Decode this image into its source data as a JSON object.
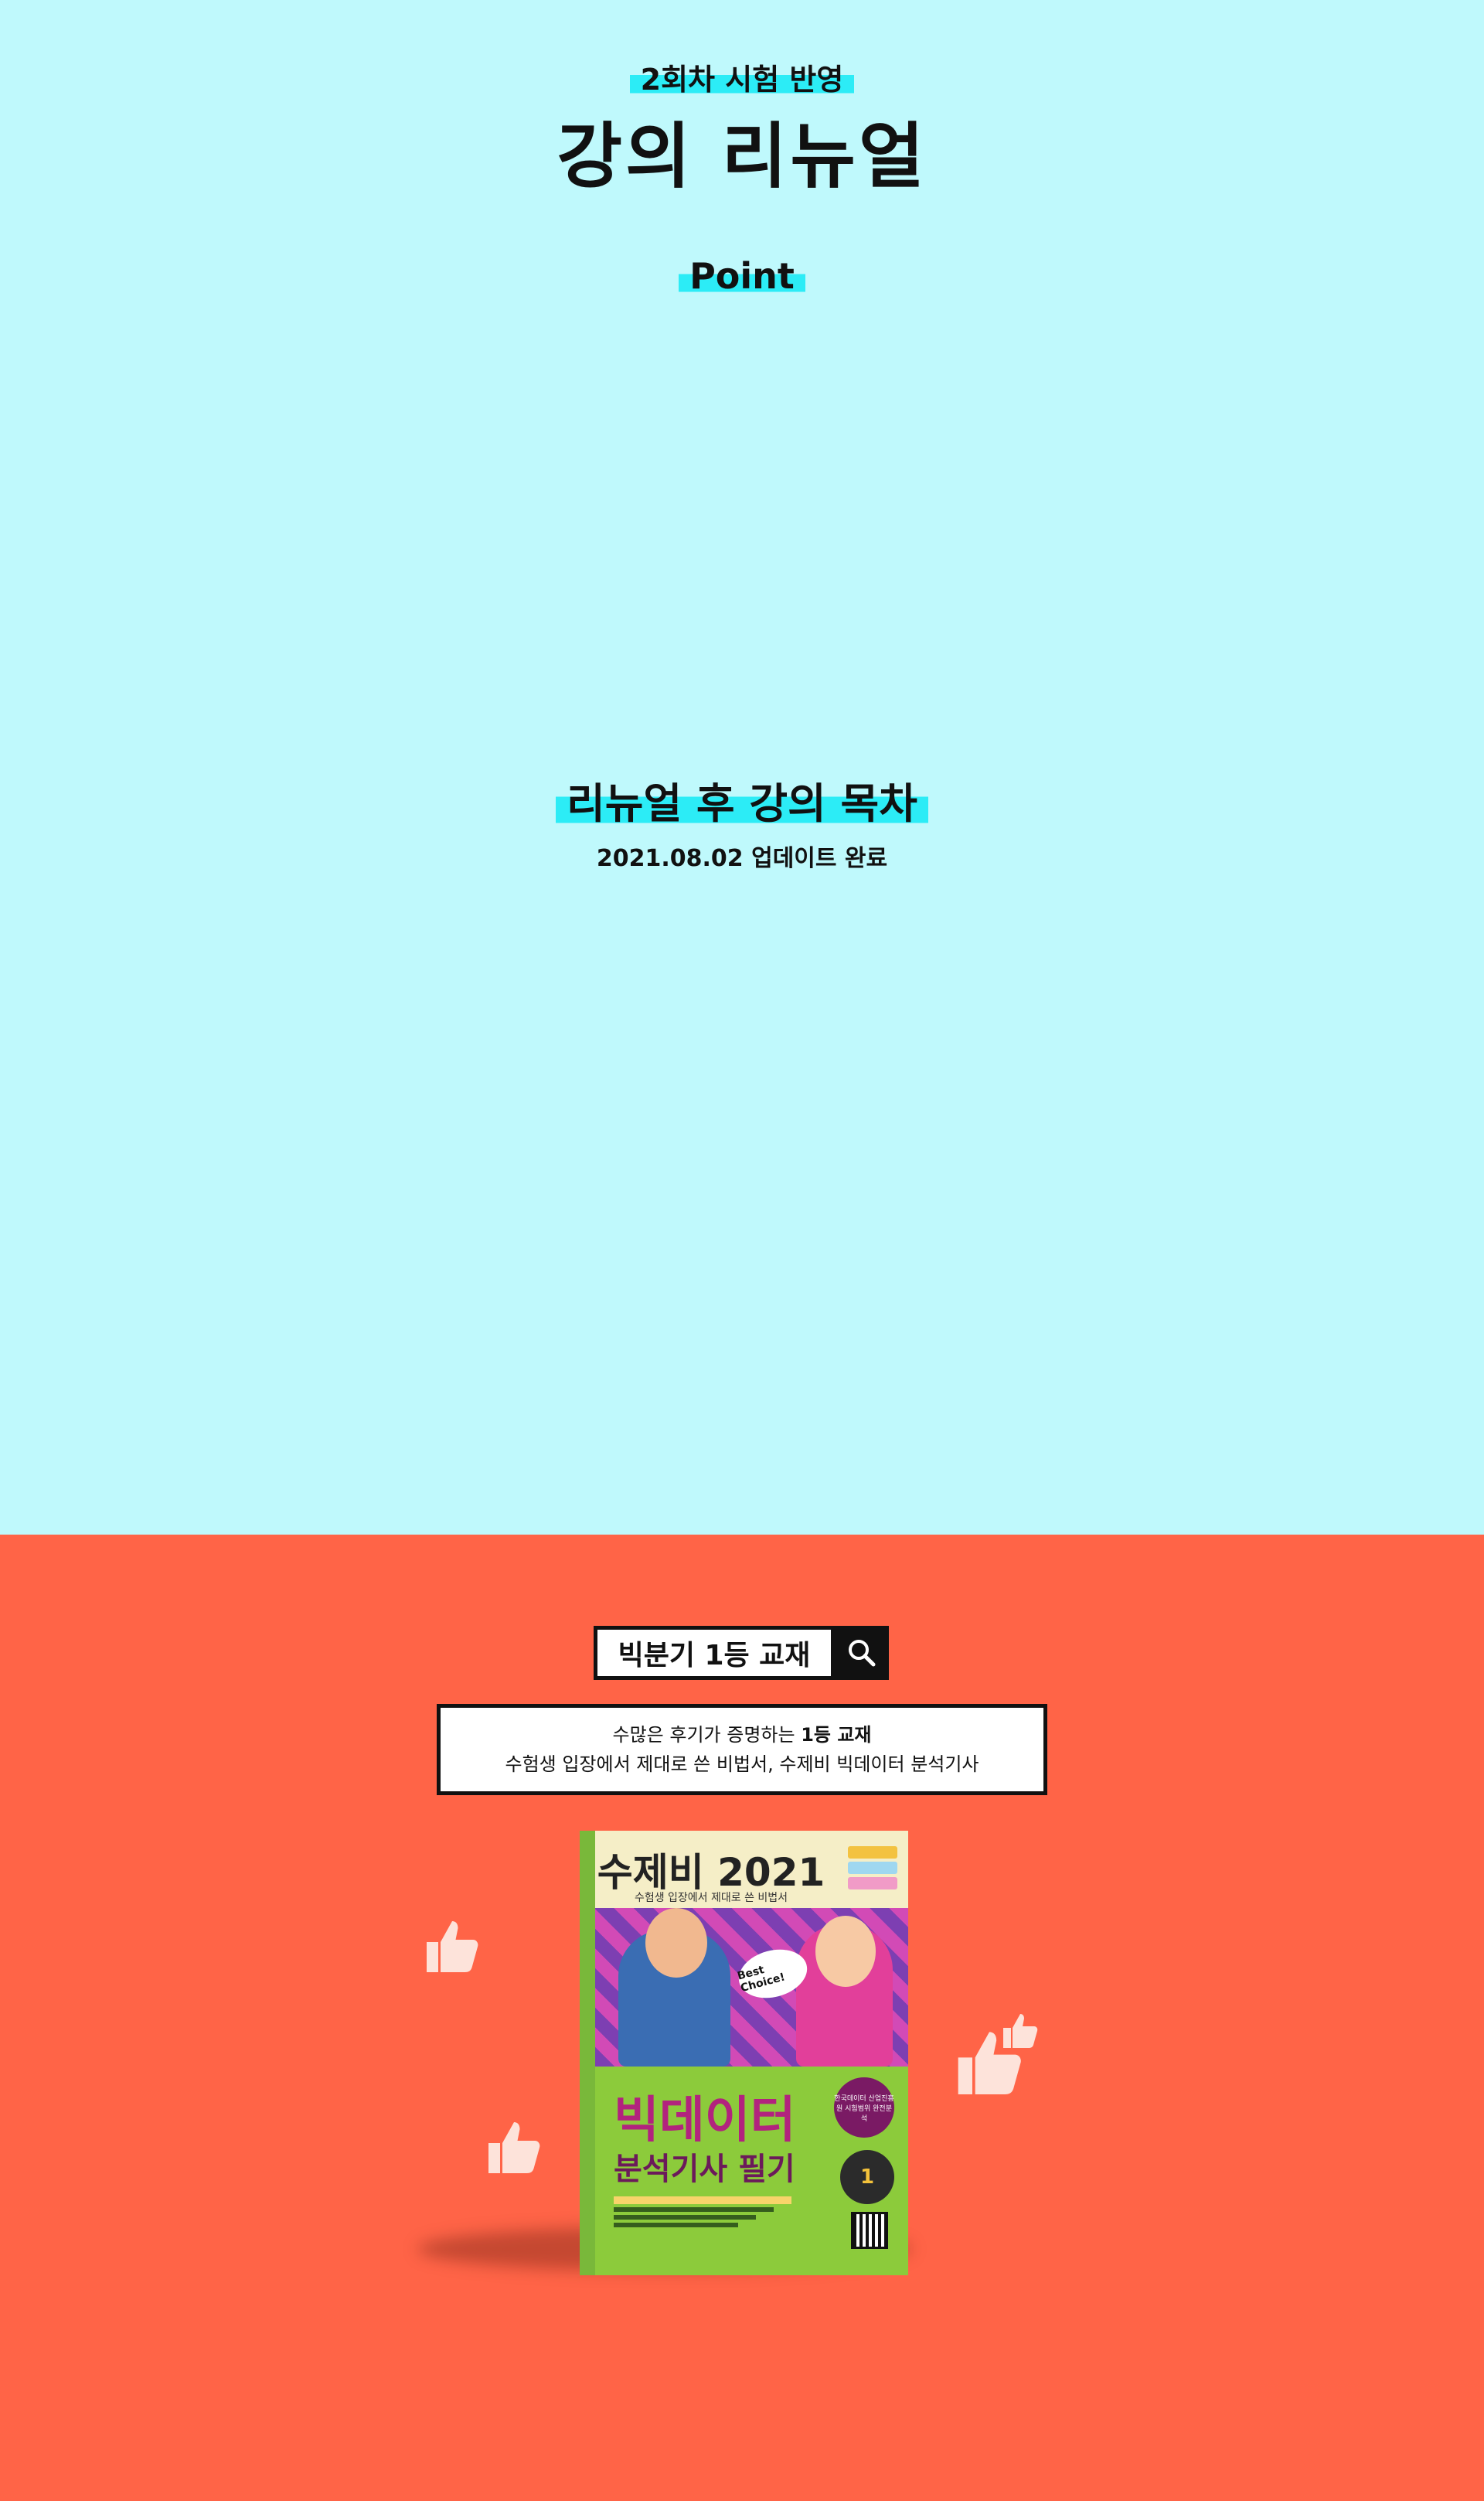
{
  "top": {
    "badge": "2회차 시험 반영",
    "title": "강의 리뉴얼",
    "point_label": "Point",
    "toc_title": "리뉴얼 후 강의 목차",
    "update_note": "2021.08.02 업데이트 완료"
  },
  "promo": {
    "search_text": "빅분기 1등 교재",
    "desc_line1_prefix": "수많은 후기가 증명하는 ",
    "desc_line1_bold": "1등 교재",
    "desc_line2": "수험생 입장에서 제대로 쓴 비법서, 수제비 빅데이터 분석기사"
  },
  "book": {
    "series_title": "수제비 2021",
    "series_sub": "수험생 입장에서 제대로 쓴 비법서",
    "bubble": "Best Choice!",
    "main_title": "빅데이터",
    "sub_title": "분석기사 필기",
    "circle_text": "한국데이터 산업진흥원 시험범위 완전분석",
    "badge": "1"
  },
  "colors": {
    "top_bg": "#bff9fc",
    "bottom_bg": "#ff6447",
    "highlight": "#2cecf6"
  }
}
